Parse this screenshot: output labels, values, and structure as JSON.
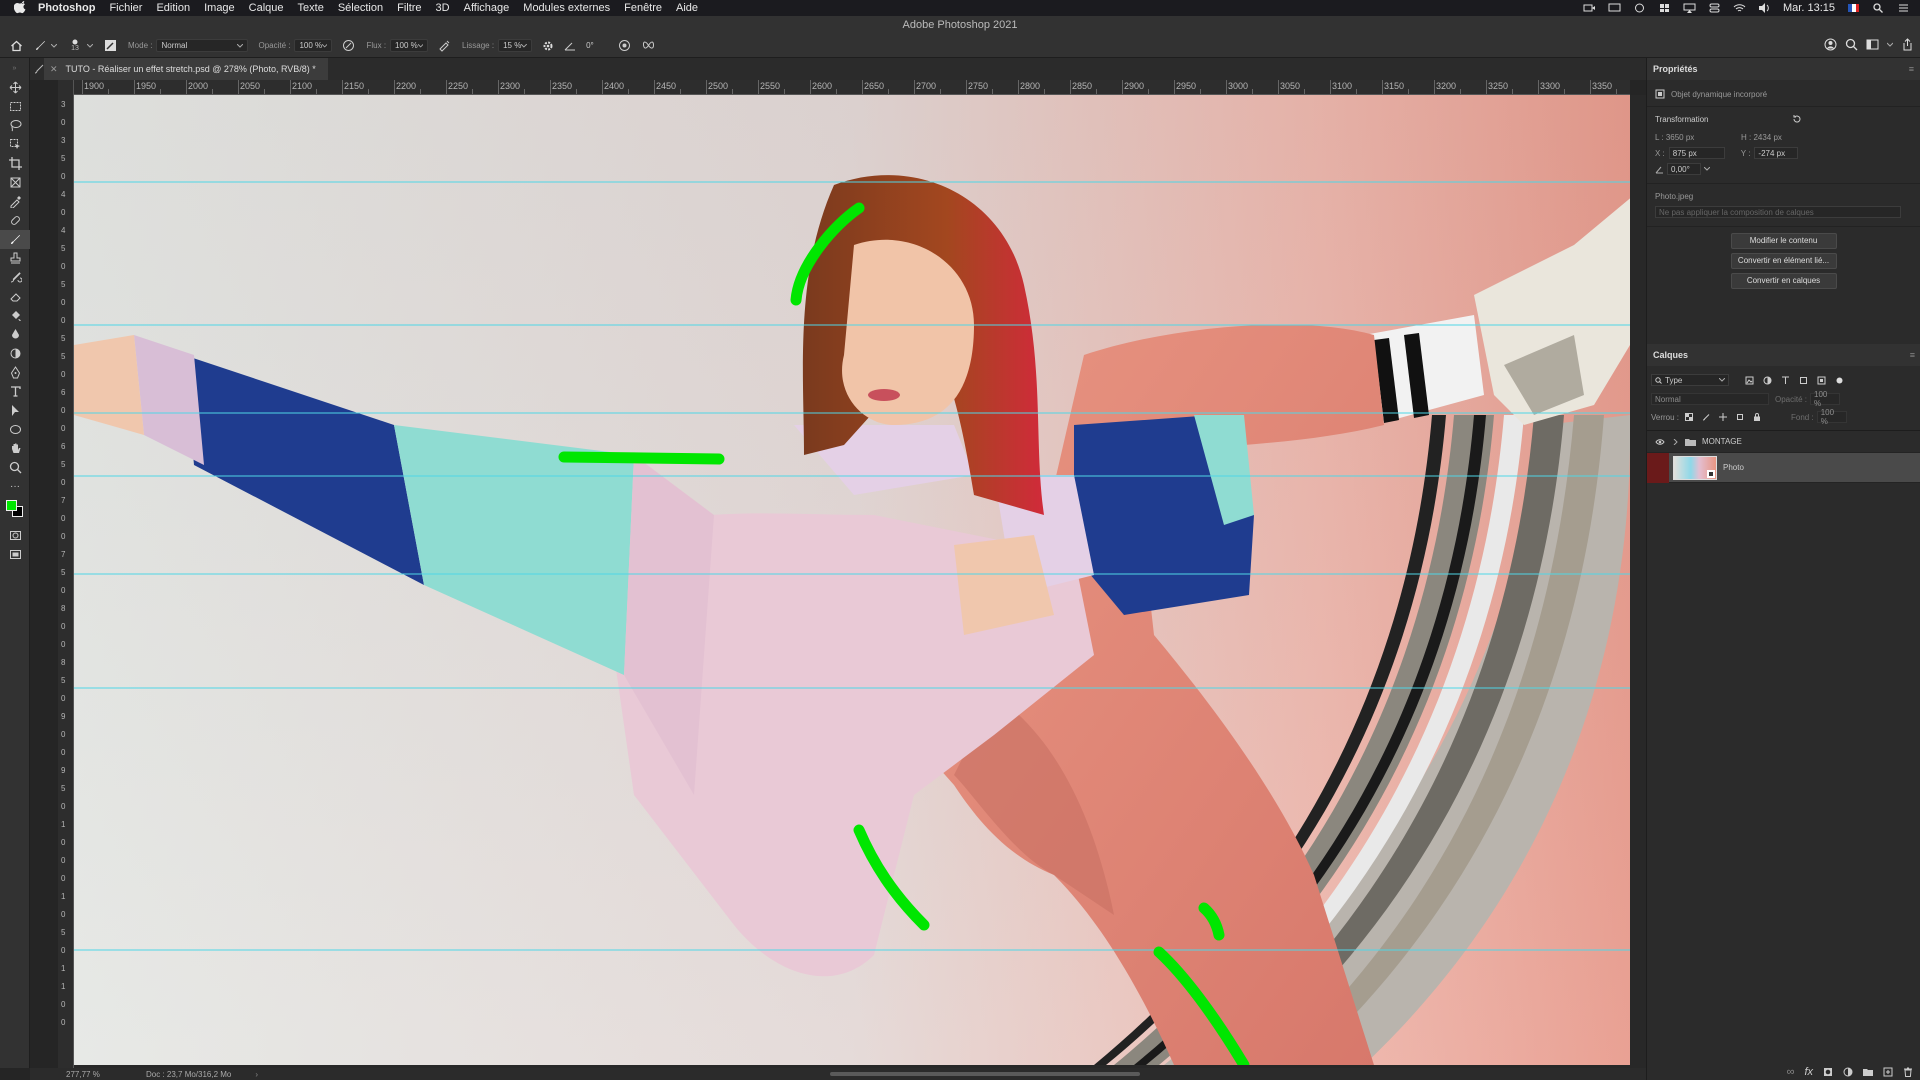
{
  "menubar": {
    "app": "Photoshop",
    "items": [
      "Fichier",
      "Edition",
      "Image",
      "Calque",
      "Texte",
      "Sélection",
      "Filtre",
      "3D",
      "Affichage",
      "Modules externes",
      "Fenêtre",
      "Aide"
    ],
    "clock": "Mar. 13:15"
  },
  "window": {
    "title": "Adobe Photoshop 2021"
  },
  "options": {
    "brush_size": "13",
    "mode_label": "Mode :",
    "mode_value": "Normal",
    "opacity_label": "Opacité :",
    "opacity_value": "100 %",
    "flow_label": "Flux :",
    "flow_value": "100 %",
    "smoothing_label": "Lissage :",
    "smoothing_value": "15 %",
    "angle_value": "0°"
  },
  "document": {
    "tab": "TUTO - Réaliser un effet stretch.psd @ 278% (Photo, RVB/8) *",
    "ruler_h": [
      "1900",
      "1950",
      "2000",
      "2050",
      "2100",
      "2150",
      "2200",
      "2250",
      "2300",
      "2350",
      "2400",
      "2450",
      "2500",
      "2550",
      "2600",
      "2650",
      "2700",
      "2750",
      "2800",
      "2850",
      "2900",
      "2950",
      "3000",
      "3050",
      "3100",
      "3150",
      "3200",
      "3250",
      "3300",
      "3350"
    ],
    "ruler_v": [
      "3",
      "0",
      "3",
      "5",
      "0",
      "4",
      "0",
      "4",
      "5",
      "0",
      "5",
      "0",
      "0",
      "5",
      "5",
      "0",
      "6",
      "0",
      "0",
      "6",
      "5",
      "0",
      "7",
      "0",
      "0",
      "7",
      "5",
      "0",
      "8",
      "0",
      "0",
      "8",
      "5",
      "0",
      "9",
      "0",
      "0",
      "9",
      "5",
      "0",
      "1",
      "0",
      "0",
      "0",
      "1",
      "0",
      "5",
      "0",
      "1",
      "1",
      "0",
      "0"
    ]
  },
  "status": {
    "zoom": "277,77 %",
    "doc": "Doc : 23,7 Mo/316,2 Mo"
  },
  "properties": {
    "title": "Propriétés",
    "object_type": "Objet dynamique incorporé",
    "transform_label": "Transformation",
    "w": "L : 3650 px",
    "h": "H : 2434 px",
    "x": "875 px",
    "x_label": "X :",
    "y": "-274 px",
    "y_label": "Y :",
    "angle": "0,00°",
    "source": "Photo.jpeg",
    "comp_placeholder": "Ne pas appliquer la composition de calques",
    "buttons": [
      "Modifier le contenu",
      "Convertir en élément lié...",
      "Convertir en calques"
    ]
  },
  "layers": {
    "title": "Calques",
    "filter": "Type",
    "blend": "Normal",
    "opacity_label": "Opacité :",
    "opacity_value": "100 %",
    "lock_label": "Verrou :",
    "fill_label": "Fond :",
    "fill_value": "100 %",
    "group": "MONTAGE",
    "layer": "Photo"
  },
  "colors": {
    "foreground": "#00e600",
    "background": "#000000",
    "guide": "#4fd6e6",
    "paint": "#00e600"
  }
}
